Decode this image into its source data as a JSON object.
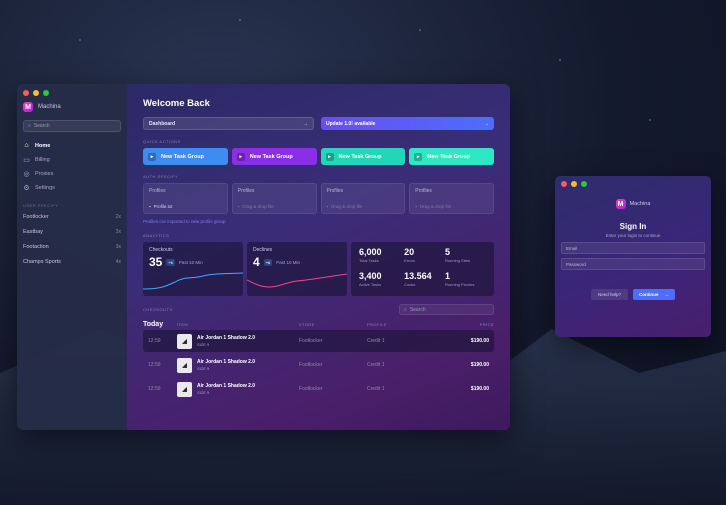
{
  "app": {
    "name": "Machina",
    "logo_letter": "M"
  },
  "sidebar": {
    "search_placeholder": "Search",
    "nav": [
      {
        "label": "Home",
        "icon": "home-icon",
        "active": true
      },
      {
        "label": "Billing",
        "icon": "card-icon"
      },
      {
        "label": "Proxies",
        "icon": "globe-icon"
      },
      {
        "label": "Settings",
        "icon": "gear-icon"
      }
    ],
    "section_label": "USER SPECIFY",
    "sites": [
      {
        "name": "Footlocker",
        "count": "2x"
      },
      {
        "name": "Eastbay",
        "count": "2x"
      },
      {
        "name": "Footaction",
        "count": "3x"
      },
      {
        "name": "Champs Sports",
        "count": "4x"
      }
    ]
  },
  "main": {
    "title": "Welcome Back",
    "dashboard_select": "Dashboard",
    "update_label": "Update 1.0! available",
    "quick_actions_label": "QUICK ACTIONS",
    "task_groups": [
      {
        "label": "New Task Group",
        "color": "#3f8cf0"
      },
      {
        "label": "New Task Group",
        "color": "#8b2fe6"
      },
      {
        "label": "New Task Group",
        "color": "#22d6b8"
      },
      {
        "label": "New Task Group",
        "color": "#2ee8c4"
      }
    ],
    "profiles_label": "AUTH SPECIFY",
    "profiles": [
      {
        "title": "Profiles",
        "sub": "Profile.txt"
      },
      {
        "title": "Profiles",
        "sub": "Drag & drop file"
      },
      {
        "title": "Profiles",
        "sub": "Drag & drop file"
      },
      {
        "title": "Profiles",
        "sub": "Drag & drop file"
      }
    ],
    "profiles_note": "Profiles.csv imported to new profile group",
    "analytics_label": "ANALYTICS",
    "checkouts_card": {
      "title": "Checkouts",
      "value": "35",
      "badge": "+6",
      "meta": "Past 10 Min"
    },
    "declines_card": {
      "title": "Declines",
      "value": "4",
      "badge": "+8",
      "meta": "Past 10 Min"
    },
    "stats": [
      {
        "value": "6,000",
        "label": "Total Tasks"
      },
      {
        "value": "20",
        "label": "Errors"
      },
      {
        "value": "5",
        "label": "Running Sites"
      },
      {
        "value": "3,400",
        "label": "Active Tasks"
      },
      {
        "value": "13.564",
        "label": "Cooks"
      },
      {
        "value": "1",
        "label": "Running Proxies"
      }
    ],
    "checkouts_label": "CHECKOUTS",
    "search_placeholder": "Search",
    "table": {
      "today": "Today",
      "columns": [
        "ITEM",
        "STORE",
        "PROFILE",
        "PRICE"
      ],
      "rows": [
        {
          "time": "12:59",
          "item": "Air Jordan 1 Shadow 2.0",
          "size": "SIZE 9",
          "store": "Footlocker",
          "profile": "Credit 1",
          "price": "$190.00"
        },
        {
          "time": "12:59",
          "item": "Air Jordan 1 Shadow 2.0",
          "size": "SIZE 9",
          "store": "Footlocker",
          "profile": "Credit 1",
          "price": "$190.00"
        },
        {
          "time": "12:59",
          "item": "Air Jordan 1 Shadow 2.0",
          "size": "SIZE 9",
          "store": "Footlocker",
          "profile": "Credit 1",
          "price": "$190.00"
        }
      ]
    }
  },
  "signin": {
    "brand": "Machina",
    "title": "Sign In",
    "subtitle": "Enter your login to continue",
    "email_placeholder": "Email",
    "password_placeholder": "Password",
    "help_label": "Need help?",
    "continue_label": "Continue"
  }
}
